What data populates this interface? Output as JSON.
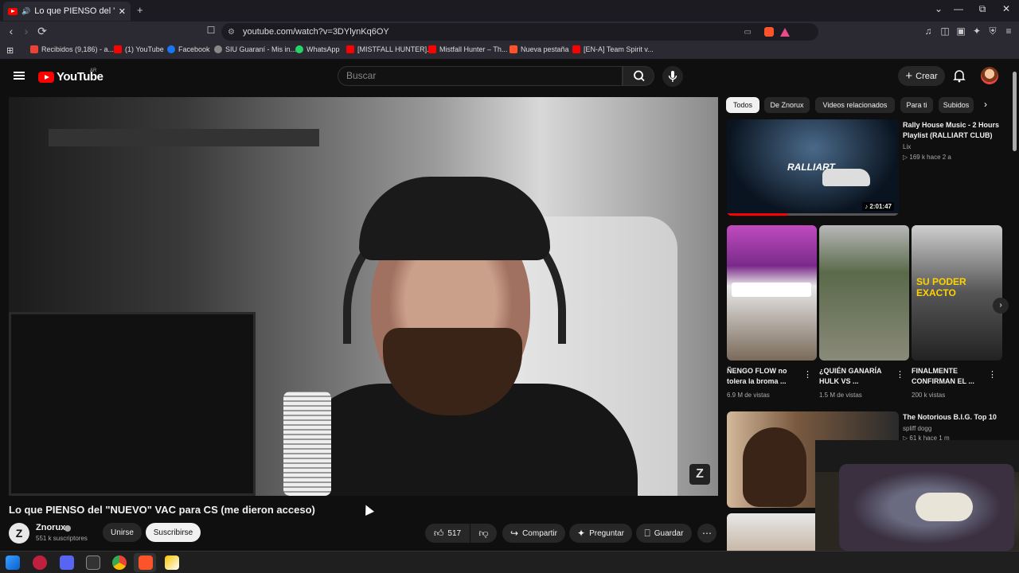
{
  "browser": {
    "tab_title": "Lo que PIENSO del \"NUEVO\"",
    "new_tab": "+",
    "url": "youtube.com/watch?v=3DYlynKq6OY",
    "window_controls": [
      "⌄",
      "—",
      "⧉",
      "✕"
    ]
  },
  "bookmarks": [
    {
      "label": "Recibidos (9,186) - a...",
      "color": "#ea4335"
    },
    {
      "label": "(1) YouTube",
      "color": "#ff0000"
    },
    {
      "label": "Facebook",
      "color": "#1877f2"
    },
    {
      "label": "SIU Guaraní - Mis in...",
      "color": "#888888"
    },
    {
      "label": "WhatsApp",
      "color": "#25d366"
    },
    {
      "label": "[MISTFALL HUNTER]...",
      "color": "#ff0000"
    },
    {
      "label": "Mistfall Hunter – Th...",
      "color": "#ff0000"
    },
    {
      "label": "Nueva pestaña",
      "color": "#fb542b"
    },
    {
      "label": "[EN-A] Team Spirit v...",
      "color": "#ff0000"
    }
  ],
  "yt": {
    "logo": "YouTube",
    "region": "AR",
    "search_placeholder": "Buscar",
    "create_label": "Crear"
  },
  "video": {
    "title": "Lo que PIENSO del \"NUEVO\" VAC para CS (me dieron acceso)",
    "channel": "Znorux",
    "subscribers": "551 k suscriptores",
    "join": "Unirse",
    "subscribe": "Suscribirse",
    "likes": "517",
    "share": "Compartir",
    "ask": "Preguntar",
    "save": "Guardar",
    "watermark": "Z"
  },
  "chips": [
    "Todos",
    "De Znorux",
    "Videos relacionados",
    "Para ti",
    "Subidos"
  ],
  "related_top": {
    "title": "Rally House Music - 2 Hours Playlist (RALLIART CLUB)",
    "channel": "Lix",
    "meta": "169 k   hace 2 a",
    "duration": "2:01:47",
    "thumb_text": "RALLIART"
  },
  "shorts": [
    {
      "title": "ÑENGO FLOW no tolera la broma ...",
      "views": "6.9 M de vistas"
    },
    {
      "title": "¿QUIÉN GANARÍA HULK VS ...",
      "views": "1.5 M de vistas"
    },
    {
      "title": "FINALMENTE CONFIRMAN EL ...",
      "views": "200 k vistas",
      "thumb_text": "SU PODER EXACTO"
    }
  ],
  "related_bottom": {
    "title": "The Notorious B.I.G. Top 10",
    "channel": "spliff dogg",
    "meta": "61 k   hace 1 m"
  }
}
